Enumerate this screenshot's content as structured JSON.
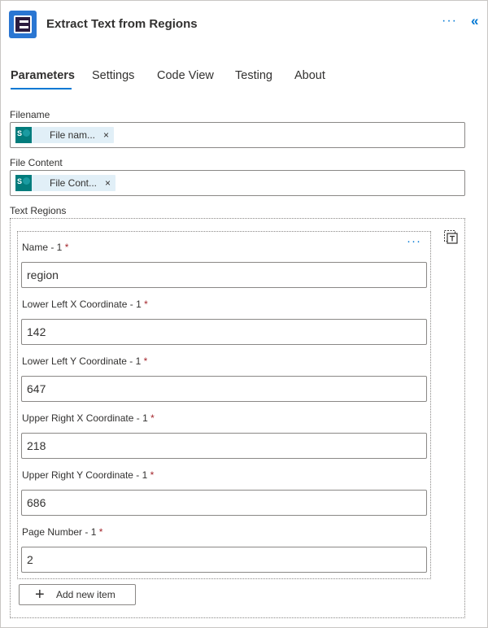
{
  "header": {
    "title": "Extract Text from Regions",
    "more_icon": "more-horizontal-icon",
    "collapse_icon": "double-chevron-left-icon",
    "accent": "#0078d4"
  },
  "tabs": [
    {
      "label": "Parameters",
      "active": true
    },
    {
      "label": "Settings",
      "active": false
    },
    {
      "label": "Code View",
      "active": false
    },
    {
      "label": "Testing",
      "active": false
    },
    {
      "label": "About",
      "active": false
    }
  ],
  "filename": {
    "label": "Filename",
    "token_label": "File nam...",
    "token_icon": "sharepoint-icon",
    "remove": "×"
  },
  "file_content": {
    "label": "File Content",
    "token_label": "File Cont...",
    "token_icon": "sharepoint-icon",
    "remove": "×"
  },
  "text_regions": {
    "label": "Text Regions",
    "switch_icon": "switch-to-text-mode-icon",
    "item_more": "···",
    "required_mark": "*",
    "fields": [
      {
        "label": "Name - 1",
        "value": "region"
      },
      {
        "label": "Lower Left X Coordinate - 1",
        "value": "142"
      },
      {
        "label": "Lower Left Y Coordinate - 1",
        "value": "647"
      },
      {
        "label": "Upper Right X Coordinate - 1",
        "value": "218"
      },
      {
        "label": "Upper Right Y Coordinate - 1",
        "value": "686"
      },
      {
        "label": "Page Number - 1",
        "value": "2"
      }
    ],
    "add_button": "Add new item"
  }
}
